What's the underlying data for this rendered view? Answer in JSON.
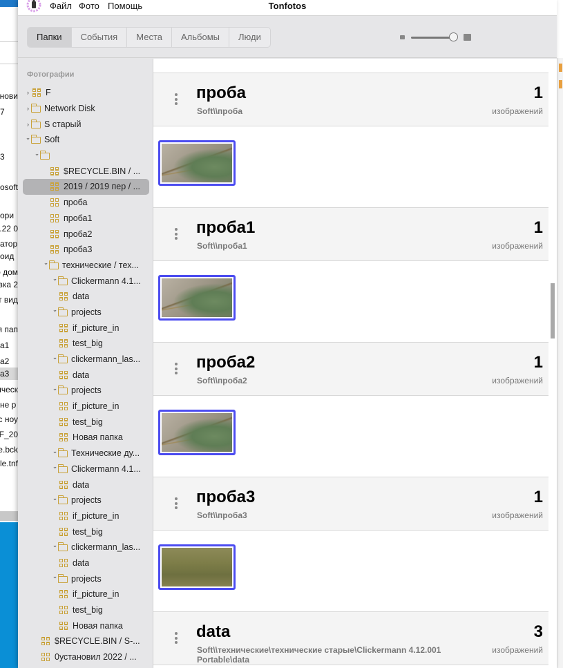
{
  "background_window": {
    "fragments": [
      "нови",
      "7",
      "3",
      "osoft",
      "ори",
      "0 22.",
      "атор",
      "оид",
      "о дом",
      "узка 2",
      "т вид",
      "я пап",
      "а1",
      "а2",
      "а3",
      "ическ",
      "не р",
      "с ноу",
      "FF_20",
      "le.bck",
      "le.tnf"
    ]
  },
  "app": {
    "title": "Tonfotos",
    "menu": [
      "Файл",
      "Фото",
      "Помощь"
    ]
  },
  "toolbar": {
    "tabs": [
      {
        "label": "Папки",
        "active": true
      },
      {
        "label": "События",
        "active": false
      },
      {
        "label": "Места",
        "active": false
      },
      {
        "label": "Альбомы",
        "active": false
      },
      {
        "label": "Люди",
        "active": false
      }
    ],
    "thumb_size_slider": 1.0
  },
  "sidebar": {
    "heading": "Фотографии",
    "tree": [
      {
        "label": "F",
        "depth": 0,
        "chevron": "right",
        "icon": "grid"
      },
      {
        "label": "Network Disk",
        "depth": 0,
        "chevron": "right",
        "icon": "folder"
      },
      {
        "label": "S старый",
        "depth": 0,
        "chevron": "right",
        "icon": "folder"
      },
      {
        "label": "Soft",
        "depth": 0,
        "chevron": "down",
        "icon": "folder"
      },
      {
        "label": "",
        "depth": 1,
        "chevron": "down",
        "icon": "folder"
      },
      {
        "label": "$RECYCLE.BIN / ...",
        "depth": 2,
        "icon": "grid"
      },
      {
        "label": "2019 / 2019 пер / ...",
        "depth": 2,
        "icon": "grid",
        "selected": true
      },
      {
        "label": "проба",
        "depth": 2,
        "icon": "grid"
      },
      {
        "label": "проба1",
        "depth": 2,
        "icon": "grid"
      },
      {
        "label": "проба2",
        "depth": 2,
        "icon": "grid"
      },
      {
        "label": "проба3",
        "depth": 2,
        "icon": "grid"
      },
      {
        "label": "технические / тех...",
        "depth": 2,
        "chevron": "down",
        "icon": "folder"
      },
      {
        "label": "Clickermann 4.1...",
        "depth": 3,
        "chevron": "down",
        "icon": "folder"
      },
      {
        "label": "data",
        "depth": 3,
        "icon": "grid"
      },
      {
        "label": "projects",
        "depth": 3,
        "chevron": "down",
        "icon": "folder"
      },
      {
        "label": "if_picture_in",
        "depth": 3,
        "icon": "grid"
      },
      {
        "label": "test_big",
        "depth": 3,
        "icon": "grid"
      },
      {
        "label": "clickermann_las...",
        "depth": 3,
        "chevron": "down",
        "icon": "folder"
      },
      {
        "label": "data",
        "depth": 3,
        "icon": "grid"
      },
      {
        "label": "projects",
        "depth": 3,
        "chevron": "down",
        "icon": "folder"
      },
      {
        "label": "if_picture_in",
        "depth": 3,
        "icon": "grid"
      },
      {
        "label": "test_big",
        "depth": 3,
        "icon": "grid"
      },
      {
        "label": "Новая папка",
        "depth": 3,
        "icon": "grid"
      },
      {
        "label": "Технические ду...",
        "depth": 3,
        "chevron": "down",
        "icon": "folder"
      },
      {
        "label": "Clickermann 4.1...",
        "depth": 3,
        "chevron": "down",
        "icon": "folder"
      },
      {
        "label": "data",
        "depth": 3,
        "icon": "grid"
      },
      {
        "label": "projects",
        "depth": 3,
        "chevron": "down",
        "icon": "folder"
      },
      {
        "label": "if_picture_in",
        "depth": 3,
        "icon": "grid"
      },
      {
        "label": "test_big",
        "depth": 3,
        "icon": "grid"
      },
      {
        "label": "clickermann_las...",
        "depth": 3,
        "chevron": "down",
        "icon": "folder"
      },
      {
        "label": "data",
        "depth": 3,
        "icon": "grid"
      },
      {
        "label": "projects",
        "depth": 3,
        "chevron": "down",
        "icon": "folder"
      },
      {
        "label": "if_picture_in",
        "depth": 3,
        "icon": "grid"
      },
      {
        "label": "test_big",
        "depth": 3,
        "icon": "grid"
      },
      {
        "label": "Новая папка",
        "depth": 3,
        "icon": "grid"
      },
      {
        "label": "$RECYCLE.BIN / S-...",
        "depth": 1,
        "icon": "grid"
      },
      {
        "label": "0установил 2022 / ...",
        "depth": 1,
        "icon": "grid"
      }
    ]
  },
  "main": {
    "sections": [
      {
        "title": "проба",
        "path": "Soft\\\\проба",
        "count": "1",
        "unit": "изображений",
        "photos": [
          "lizard"
        ]
      },
      {
        "title": "проба1",
        "path": "Soft\\\\проба1",
        "count": "1",
        "unit": "изображений",
        "photos": [
          "lizard"
        ]
      },
      {
        "title": "проба2",
        "path": "Soft\\\\проба2",
        "count": "1",
        "unit": "изображений",
        "photos": [
          "lizard"
        ]
      },
      {
        "title": "проба3",
        "path": "Soft\\\\проба3",
        "count": "1",
        "unit": "изображений",
        "photos": [
          "grass"
        ]
      },
      {
        "title": "data",
        "path": "Soft\\\\технические\\технические старые\\Clickermann 4.12.001 Portable\\data",
        "count": "3",
        "unit": "изображений",
        "photos": []
      }
    ]
  },
  "colors": {
    "accent_selection": "#4c4cf0",
    "folder_icon": "#c9a23a",
    "selected_row": "#b3b3b5"
  }
}
